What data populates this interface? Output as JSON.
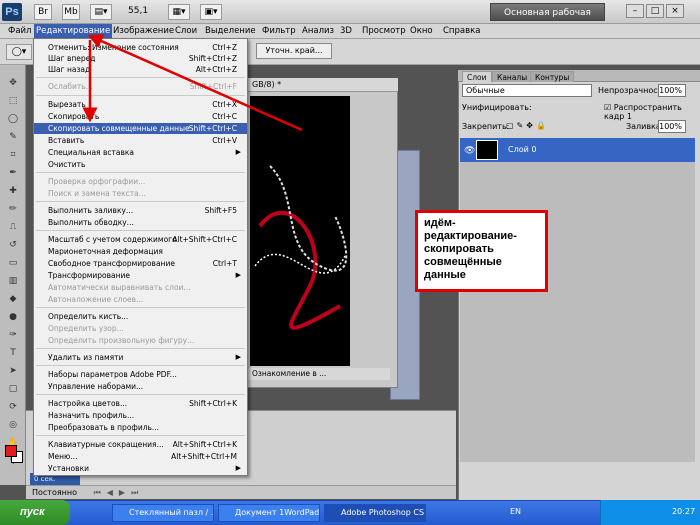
{
  "app": {
    "logo": "Ps",
    "zoom": "55,1",
    "workspace_label": "Основная рабочая среда",
    "window_controls": [
      "–",
      "□",
      "×"
    ]
  },
  "menubar": {
    "items": [
      "Файл",
      "Редактирование",
      "Изображение",
      "Слои",
      "Выделение",
      "Фильтр",
      "Анализ",
      "3D",
      "Просмотр",
      "Окно",
      "Справка"
    ]
  },
  "options_bar": {
    "refine_edge_label": "Уточн. край..."
  },
  "document": {
    "title": "GB/8) *",
    "status": "Ознакомление в ..."
  },
  "edit_menu": {
    "items": [
      {
        "label": "Отменить: Изменение состояния",
        "shortcut": "Ctrl+Z"
      },
      {
        "label": "Шаг вперед",
        "shortcut": "Shift+Ctrl+Z"
      },
      {
        "label": "Шаг назад",
        "shortcut": "Alt+Ctrl+Z"
      },
      {
        "label": "Ослабить...",
        "shortcut": "Shift+Ctrl+F"
      },
      {
        "label": "Вырезать",
        "shortcut": "Ctrl+X"
      },
      {
        "label": "Скопировать",
        "shortcut": "Ctrl+C"
      },
      {
        "label": "Скопировать совмещенные данные",
        "shortcut": "Shift+Ctrl+C"
      },
      {
        "label": "Вставить",
        "shortcut": "Ctrl+V"
      },
      {
        "label": "Специальная вставка",
        "shortcut": ""
      },
      {
        "label": "Очистить",
        "shortcut": ""
      },
      {
        "label": "Проверка орфографии...",
        "shortcut": ""
      },
      {
        "label": "Поиск и замена текста...",
        "shortcut": ""
      },
      {
        "label": "Выполнить заливку...",
        "shortcut": "Shift+F5"
      },
      {
        "label": "Выполнить обводку...",
        "shortcut": ""
      },
      {
        "label": "Масштаб с учетом содержимого",
        "shortcut": "Alt+Shift+Ctrl+C"
      },
      {
        "label": "Марионеточная деформация",
        "shortcut": ""
      },
      {
        "label": "Свободное трансформирование",
        "shortcut": "Ctrl+T"
      },
      {
        "label": "Трансформирование",
        "shortcut": ""
      },
      {
        "label": "Автоматически выравнивать слои...",
        "shortcut": ""
      },
      {
        "label": "Автоналожение слоев...",
        "shortcut": ""
      },
      {
        "label": "Определить кисть...",
        "shortcut": ""
      },
      {
        "label": "Определить узор...",
        "shortcut": ""
      },
      {
        "label": "Определить произвольную фигуру...",
        "shortcut": ""
      },
      {
        "label": "Удалить из памяти",
        "shortcut": ""
      },
      {
        "label": "Наборы параметров Adobe PDF...",
        "shortcut": ""
      },
      {
        "label": "Управление наборами...",
        "shortcut": ""
      },
      {
        "label": "Настройка цветов...",
        "shortcut": "Shift+Ctrl+K"
      },
      {
        "label": "Назначить профиль...",
        "shortcut": ""
      },
      {
        "label": "Преобразовать в профиль...",
        "shortcut": ""
      },
      {
        "label": "Клавиатурные сокращения...",
        "shortcut": "Alt+Shift+Ctrl+K"
      },
      {
        "label": "Меню...",
        "shortcut": "Alt+Shift+Ctrl+M"
      },
      {
        "label": "Установки",
        "shortcut": ""
      }
    ]
  },
  "callout": {
    "text": "идём-редактирование-скопировать совмещённые данные"
  },
  "layers_panel": {
    "tabs": [
      "Слои",
      "Каналы",
      "Контуры"
    ],
    "blend_mode": "Обычные",
    "opacity_label": "Непрозрачность:",
    "opacity_value": "100%",
    "unify_label": "Унифицировать:",
    "propagate_label": "Распространить кадр 1",
    "lock_label": "Закрепить:",
    "fill_label": "Заливка:",
    "fill_value": "100%",
    "layer_name": "Слой 0"
  },
  "animation_panel": {
    "frame_time": "0 сек.",
    "loop_label": "Постоянно"
  },
  "taskbar": {
    "start_label": "пуск",
    "tasks": [
      "Стеклянный пазл / ...",
      "Документ 1WordPad...",
      "Adobe Photoshop CS..."
    ],
    "language": "EN",
    "clock": "20:27"
  },
  "colors": {
    "highlight": "#3a5fb0",
    "callout_border": "#e00000",
    "foreground_swatch": "#e61b1b",
    "layer_selected": "#3566c4"
  }
}
